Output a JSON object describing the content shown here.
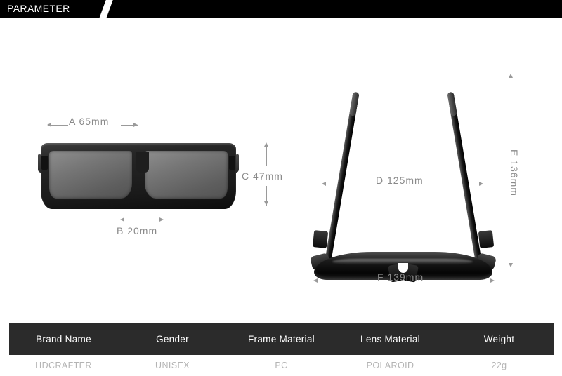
{
  "header": {
    "title": "PARAMETER"
  },
  "dimensions": {
    "a": "A  65mm",
    "b": "B  20mm",
    "c": "C  47mm",
    "d": "D  125mm",
    "e": "E  136mm",
    "f": "F  139mm"
  },
  "table": {
    "headers": [
      "Brand Name",
      "Gender",
      "Frame Material",
      "Lens Material",
      "Weight"
    ],
    "row": [
      "HDCRAFTER",
      "UNISEX",
      "PC",
      "POLAROID",
      "22g"
    ]
  },
  "colors": {
    "header_bar": "#000000",
    "table_header": "#2b2b2b",
    "dimension_text": "#8a8a8a",
    "dimension_line": "#9a9a9a",
    "value_text": "#b4b4b4"
  }
}
